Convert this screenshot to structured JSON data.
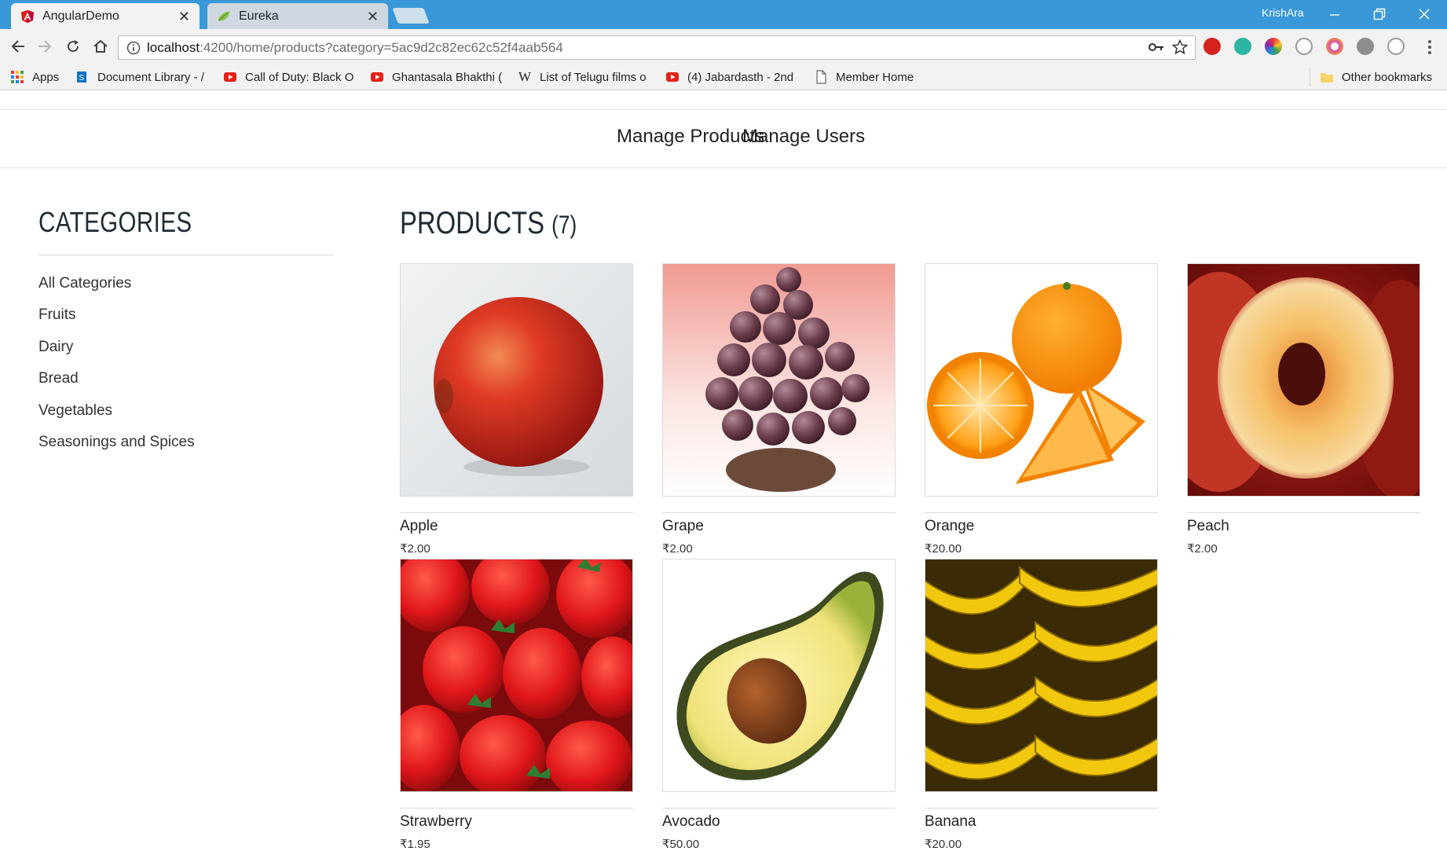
{
  "browser": {
    "tabs": [
      {
        "title": "AngularDemo",
        "active": true,
        "icon": "angular-icon"
      },
      {
        "title": "Eureka",
        "active": false,
        "icon": "leaf-icon"
      }
    ],
    "profile_name": "KrishAra",
    "url_host": "localhost",
    "url_path": ":4200/home/products?category=5ac9d2c82ec62c52f4aab564",
    "bookmarks": [
      {
        "label": "Apps",
        "icon": "apps-grid-icon"
      },
      {
        "label": "Document Library - /",
        "icon": "sharepoint-icon"
      },
      {
        "label": "Call of Duty: Black O",
        "icon": "youtube-icon"
      },
      {
        "label": "Ghantasala Bhakthi (",
        "icon": "youtube-icon"
      },
      {
        "label": "List of Telugu films o",
        "icon": "wikipedia-icon"
      },
      {
        "label": "(4) Jabardasth - 2nd",
        "icon": "youtube-icon"
      },
      {
        "label": "Member Home",
        "icon": "page-icon"
      }
    ],
    "other_bookmarks": "Other bookmarks"
  },
  "nav": {
    "manage_products": "Manage Products",
    "manage_users": "Manage Users"
  },
  "sidebar": {
    "title": "CATEGORIES",
    "categories": [
      "All Categories",
      "Fruits",
      "Dairy",
      "Bread",
      "Vegetables",
      "Seasonings and Spices"
    ]
  },
  "products": {
    "title": "PRODUCTS",
    "count": "(7)",
    "items": [
      {
        "name": "Apple",
        "price": "₹2.00"
      },
      {
        "name": "Grape",
        "price": "₹2.00"
      },
      {
        "name": "Orange",
        "price": "₹20.00"
      },
      {
        "name": "Peach",
        "price": "₹2.00"
      },
      {
        "name": "Strawberry",
        "price": "₹1.95"
      },
      {
        "name": "Avocado",
        "price": "₹50.00"
      },
      {
        "name": "Banana",
        "price": "₹20.00"
      }
    ]
  },
  "colors": {
    "titlebar": "#3a98d8",
    "chrome": "#f2f2f2",
    "heading": "#1f2b33"
  }
}
